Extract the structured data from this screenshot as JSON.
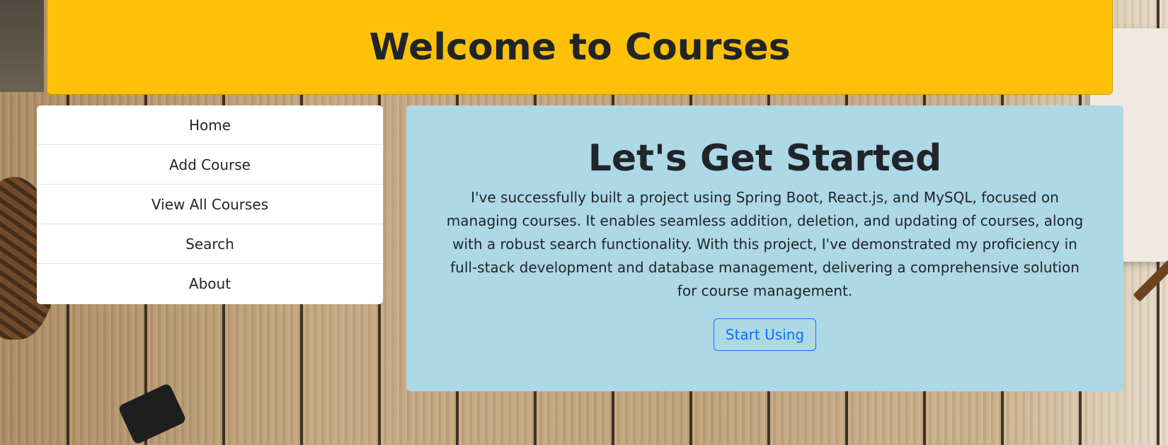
{
  "header": {
    "title": "Welcome to Courses"
  },
  "menu": {
    "items": [
      {
        "label": "Home"
      },
      {
        "label": "Add Course"
      },
      {
        "label": "View All Courses"
      },
      {
        "label": "Search"
      },
      {
        "label": "About"
      }
    ]
  },
  "main": {
    "heading": "Let's Get Started",
    "description": "I've successfully built a project using Spring Boot, React.js, and MySQL, focused on managing courses. It enables seamless addition, deletion, and updating of courses, along with a robust search functionality. With this project, I've demonstrated my proficiency in full-stack development and database management, delivering a comprehensive solution for course management.",
    "button_label": "Start Using"
  },
  "colors": {
    "header_bg": "#ffc107",
    "card_bg": "#add8e6",
    "button_accent": "#0d6efd",
    "menu_bg": "#ffffff"
  }
}
